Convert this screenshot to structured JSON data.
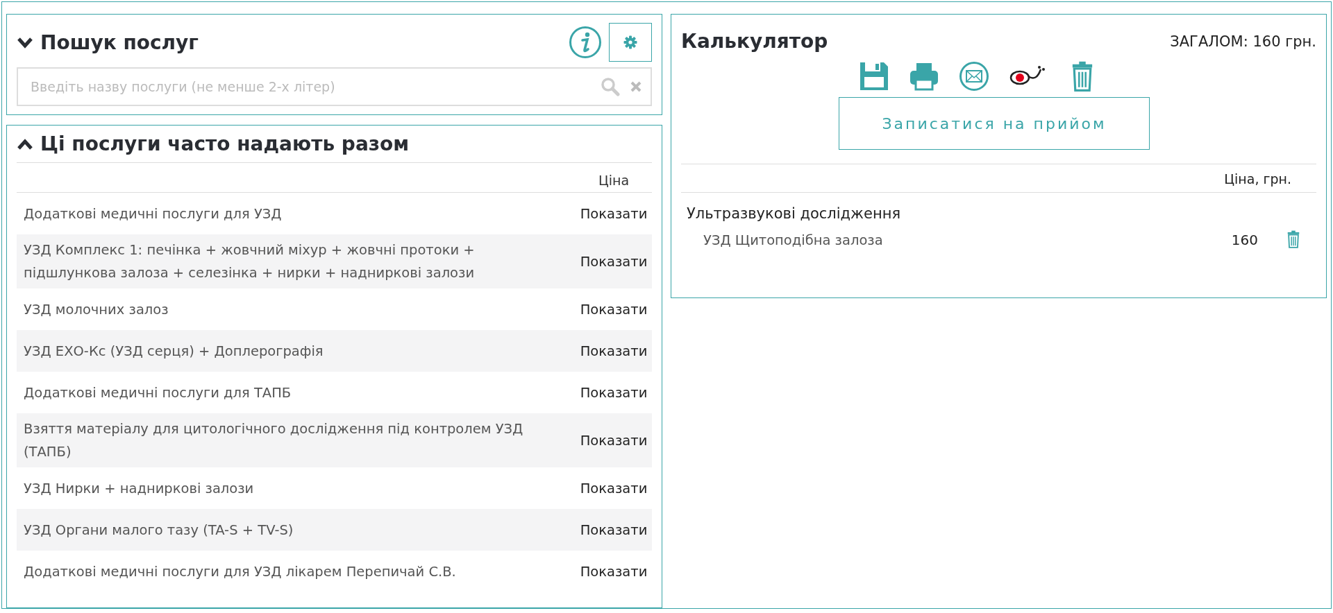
{
  "search_panel": {
    "title": "Пошук послуг",
    "search": {
      "placeholder": "Введіть назву послуги (не менше 2-х літер)"
    }
  },
  "related_panel": {
    "title": "Ці послуги часто надають разом",
    "price_column": "Ціна",
    "rows": [
      {
        "name": "Додаткові медичні послуги для УЗД",
        "price": "Показати"
      },
      {
        "name": "УЗД Комплекс 1: печінка + жовчний міхур + жовчні протоки + підшлункова залоза + селезінка + нирки + надниркові залози",
        "price": "Показати"
      },
      {
        "name": "УЗД молочних залоз",
        "price": "Показати"
      },
      {
        "name": "УЗД ЕХО-Кс (УЗД серця) + Доплерографія",
        "price": "Показати"
      },
      {
        "name": "Додаткові медичні послуги для ТАПБ",
        "price": "Показати"
      },
      {
        "name": "Взяття матеріалу для цитологічного дослідження під контролем УЗД (ТАПБ)",
        "price": "Показати"
      },
      {
        "name": "УЗД Нирки + надниркові залози",
        "price": "Показати"
      },
      {
        "name": "УЗД Органи малого тазу (TA-S + TV-S)",
        "price": "Показати"
      },
      {
        "name": "Додаткові медичні послуги для УЗД лікарем Перепичай С.В.",
        "price": "Показати"
      }
    ]
  },
  "calculator": {
    "title": "Калькулятор",
    "total": "ЗАГАЛОМ: 160 грн.",
    "book_button": "Записатися на прийом",
    "price_column": "Ціна, грн.",
    "groups": [
      {
        "name": "Ультразвукові дослідження",
        "items": [
          {
            "name": "УЗД Щитоподібна залоза",
            "price": "160"
          }
        ]
      }
    ]
  }
}
